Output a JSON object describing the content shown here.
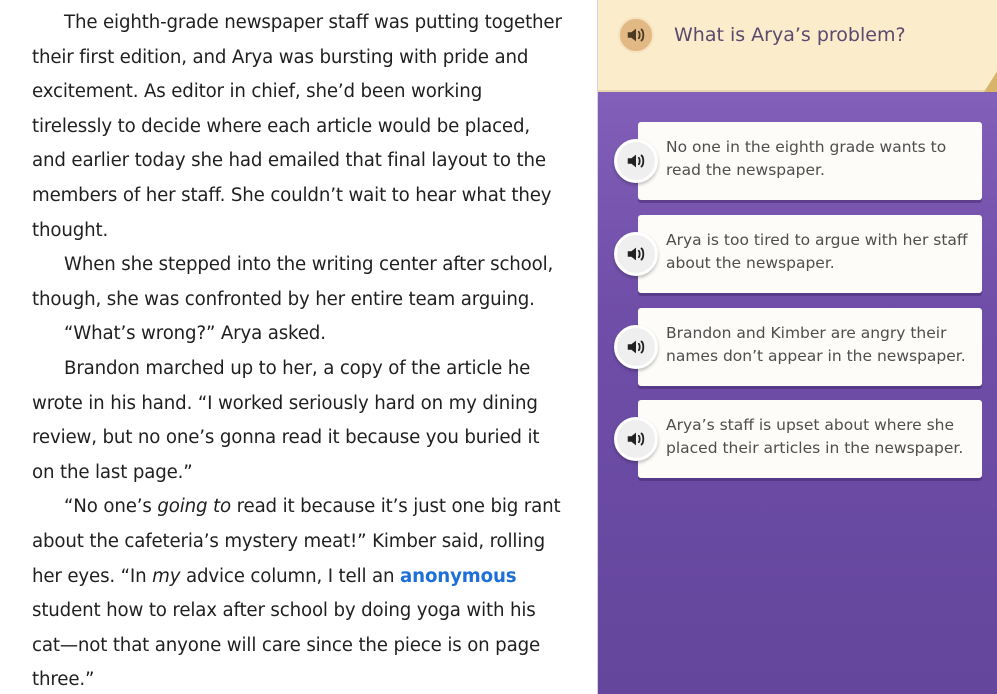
{
  "passage": {
    "paragraphs": [
      {
        "indent": true,
        "parts": [
          {
            "t": "The eighth-grade newspaper staff was putting together their first edition, and Arya was bursting with pride and excitement. As editor in chief, she’d been working tirelessly to decide where each article would be placed, and earlier today she had emailed that final layout to the members of her staff. She couldn’t wait to hear what they thought."
          }
        ]
      },
      {
        "indent": true,
        "parts": [
          {
            "t": "When she stepped into the writing center after school, though, she was confronted by her entire team arguing."
          }
        ]
      },
      {
        "indent": true,
        "parts": [
          {
            "t": "“What’s wrong?” Arya asked."
          }
        ]
      },
      {
        "indent": true,
        "parts": [
          {
            "t": "Brandon marched up to her, a copy of the article he wrote in his hand. “I worked seriously hard on my dining review, but no one’s gonna read it because you buried it on the last page.”"
          }
        ]
      },
      {
        "indent": true,
        "parts": [
          {
            "t": "“No one’s "
          },
          {
            "t": "going to",
            "style": "em"
          },
          {
            "t": " read it because it’s just one big rant about the cafeteria’s mystery meat!” Kimber said, rolling her eyes. “In "
          },
          {
            "t": "my",
            "style": "em"
          },
          {
            "t": " advice column, I tell an "
          },
          {
            "t": "anonymous",
            "style": "vocab"
          },
          {
            "t": " student how to relax after school by doing yoga with his cat—not that anyone will care since the piece is on page three.”"
          }
        ]
      }
    ]
  },
  "question": {
    "audio_icon": "speaker-icon",
    "text": "What is Arya’s problem?"
  },
  "choices": [
    {
      "text": "No one in the eighth grade wants to read the newspaper."
    },
    {
      "text": "Arya is too tired to argue with her staff about the newspaper."
    },
    {
      "text": "Brandon and Kimber are angry their names don’t appear in the newspaper."
    },
    {
      "text": "Arya’s staff is upset about where she placed their articles in the newspaper."
    }
  ],
  "colors": {
    "vocab_link": "#1e6fd9",
    "panel_top": "#8a67c0",
    "panel_bottom": "#64469c",
    "question_bg": "#fbeccb"
  }
}
